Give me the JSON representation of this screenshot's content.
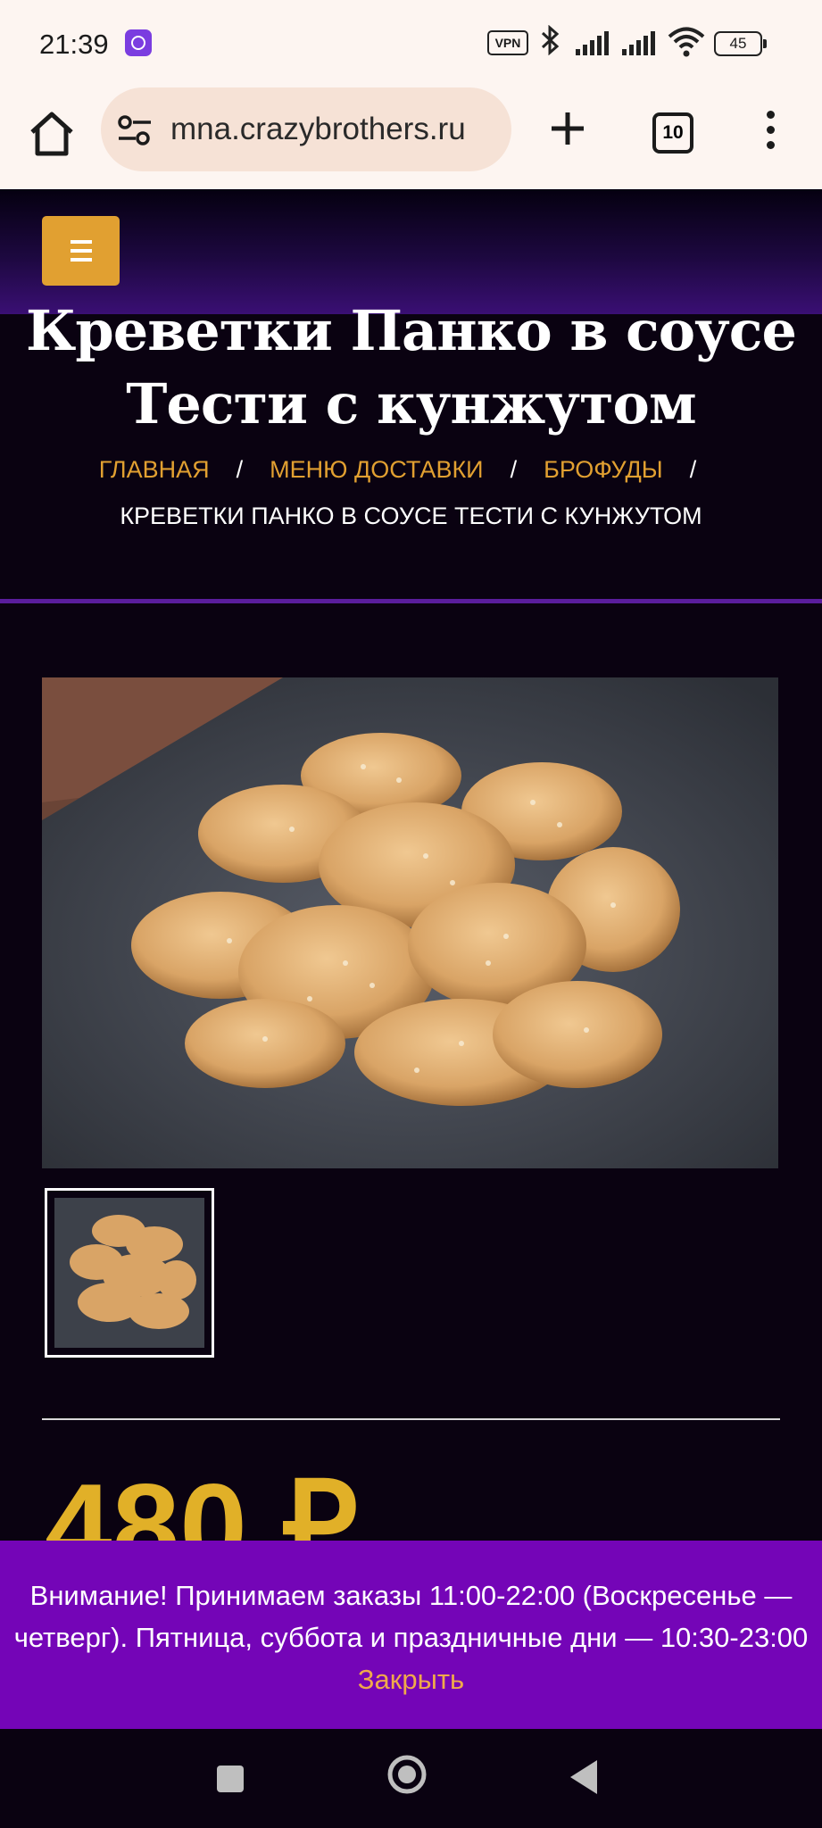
{
  "status_bar": {
    "time": "21:39",
    "vpn_label": "VPN",
    "battery": "45",
    "icons": [
      "app-badge-icon",
      "vpn-icon",
      "bluetooth-icon",
      "signal-icon",
      "signal-icon",
      "wifi-icon",
      "battery-icon"
    ]
  },
  "browser": {
    "url": "mna.crazybrothers.ru",
    "tab_count": "10",
    "icons": [
      "home-icon",
      "site-settings-icon",
      "new-tab-icon",
      "tabs-icon",
      "more-menu-icon"
    ]
  },
  "page": {
    "title_line1": "Креветки Панко в соусе",
    "title_line2": "Тести с кунжутом",
    "breadcrumbs": {
      "home": "ГЛАВНАЯ",
      "delivery_menu": "МЕНЮ ДОСТАВКИ",
      "brofoods": "БРОФУДЫ",
      "separator": "/",
      "current": "КРЕВЕТКИ ПАНКО В СОУСЕ ТЕСТИ С КУНЖУТОМ"
    },
    "price": "480 ₽",
    "accent_color": "#e1a031",
    "banner_color": "#7405b7"
  },
  "notice": {
    "text": "Внимание! Принимаем заказы 11:00-22:00 (Воскресенье — четверг). Пятница, суббота и праздничные дни — 10:30-23:00",
    "close_label": "Закрыть"
  },
  "nav": {
    "icons": [
      "recents-icon",
      "home-icon",
      "back-icon"
    ]
  }
}
